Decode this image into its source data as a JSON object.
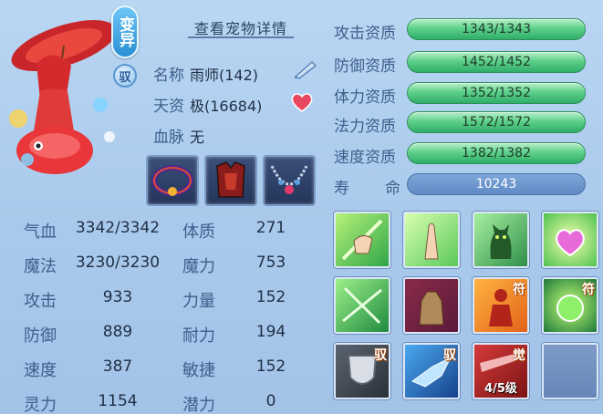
{
  "pet": {
    "variant_label": "变异",
    "bind_label": "驭",
    "detail_link": "查看宠物详情",
    "name_label": "名称",
    "name_value": "雨师(142)",
    "aptitude_label": "天资",
    "aptitude_value": "极(16684)",
    "bloodline_label": "血脉",
    "bloodline_value": "无"
  },
  "equipment": [
    {
      "name": "collar",
      "icon": "ornate-collar"
    },
    {
      "name": "armor",
      "icon": "red-armor"
    },
    {
      "name": "necklace",
      "icon": "chain-necklace"
    }
  ],
  "stats": [
    {
      "label": "气血",
      "value": "3342/3342",
      "label2": "体质",
      "value2": "271"
    },
    {
      "label": "魔法",
      "value": "3230/3230",
      "label2": "魔力",
      "value2": "753"
    },
    {
      "label": "攻击",
      "value": "933",
      "label2": "力量",
      "value2": "152"
    },
    {
      "label": "防御",
      "value": "889",
      "label2": "耐力",
      "value2": "194"
    },
    {
      "label": "速度",
      "value": "387",
      "label2": "敏捷",
      "value2": "152"
    },
    {
      "label": "灵力",
      "value": "1154",
      "label2": "潜力",
      "value2": "0"
    }
  ],
  "aptitudes": [
    {
      "label": "攻击资质",
      "value": "1343/1343"
    },
    {
      "label": "防御资质",
      "value": "1452/1452"
    },
    {
      "label": "体力资质",
      "value": "1352/1352"
    },
    {
      "label": "法力资质",
      "value": "1572/1572"
    },
    {
      "label": "速度资质",
      "value": "1382/1382"
    }
  ],
  "life": {
    "label_a": "寿",
    "label_b": "命",
    "value": "10243"
  },
  "skills": [
    {
      "icon": "green-hand-slash",
      "tag": "",
      "level": ""
    },
    {
      "icon": "praying-hands",
      "tag": "",
      "level": ""
    },
    {
      "icon": "green-cat",
      "tag": "",
      "level": ""
    },
    {
      "icon": "pink-heart-crystal",
      "tag": "",
      "level": ""
    },
    {
      "icon": "green-shatter",
      "tag": "",
      "level": ""
    },
    {
      "icon": "rock-golem",
      "tag": "",
      "level": ""
    },
    {
      "icon": "red-figure",
      "tag": "符",
      "level": ""
    },
    {
      "icon": "green-orb",
      "tag": "符",
      "level": ""
    },
    {
      "icon": "grey-shield",
      "tag": "驭",
      "level": ""
    },
    {
      "icon": "blue-bird",
      "tag": "驭",
      "level": ""
    },
    {
      "icon": "red-streak",
      "tag": "觉",
      "level": "4/5级"
    },
    {
      "icon": "empty-slot",
      "tag": "",
      "level": ""
    }
  ],
  "colors": {
    "aptitude_bar": "#4cc27d",
    "life_bar": "#5f8ac4",
    "background": "#abc9ec"
  }
}
